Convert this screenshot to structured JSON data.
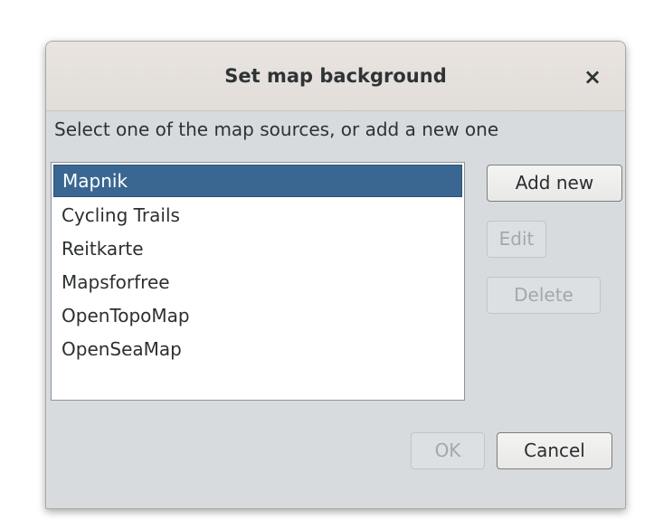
{
  "dialog": {
    "title": "Set map background",
    "close_glyph": "×",
    "close_icon": "close-icon",
    "instruction": "Select one of the map sources, or add a new one"
  },
  "map_sources": {
    "items": [
      "Mapnik",
      "Cycling Trails",
      "Reitkarte",
      "Mapsforfree",
      "OpenTopoMap",
      "OpenSeaMap"
    ],
    "selected": "Mapnik"
  },
  "side_buttons": {
    "add_new": "Add new",
    "edit": "Edit",
    "delete": "Delete"
  },
  "footer_buttons": {
    "ok": "OK",
    "cancel": "Cancel"
  },
  "colors": {
    "selection_background": "#3a6791",
    "dialog_background": "#d8dbdd",
    "titlebar_background": "#e6e1dd"
  }
}
